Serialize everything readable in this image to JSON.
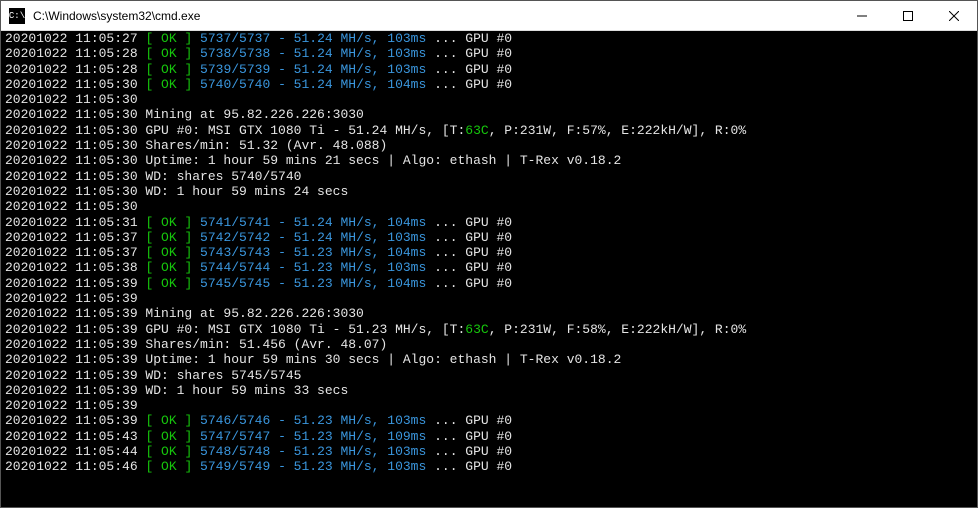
{
  "window": {
    "title": "C:\\Windows\\system32\\cmd.exe",
    "icon_label": "cmd-icon"
  },
  "lines": [
    {
      "segs": [
        {
          "c": "white",
          "t": "20201022 11:05:27 "
        },
        {
          "c": "green",
          "t": "[ OK ]"
        },
        {
          "c": "cyan",
          "t": " 5737/5737 - 51.24 MH/s, 103ms"
        },
        {
          "c": "white",
          "t": " ... GPU #0"
        }
      ]
    },
    {
      "segs": [
        {
          "c": "white",
          "t": "20201022 11:05:28 "
        },
        {
          "c": "green",
          "t": "[ OK ]"
        },
        {
          "c": "cyan",
          "t": " 5738/5738 - 51.24 MH/s, 103ms"
        },
        {
          "c": "white",
          "t": " ... GPU #0"
        }
      ]
    },
    {
      "segs": [
        {
          "c": "white",
          "t": "20201022 11:05:28 "
        },
        {
          "c": "green",
          "t": "[ OK ]"
        },
        {
          "c": "cyan",
          "t": " 5739/5739 - 51.24 MH/s, 103ms"
        },
        {
          "c": "white",
          "t": " ... GPU #0"
        }
      ]
    },
    {
      "segs": [
        {
          "c": "white",
          "t": "20201022 11:05:30 "
        },
        {
          "c": "green",
          "t": "[ OK ]"
        },
        {
          "c": "cyan",
          "t": " 5740/5740 - 51.24 MH/s, 104ms"
        },
        {
          "c": "white",
          "t": " ... GPU #0"
        }
      ]
    },
    {
      "segs": [
        {
          "c": "white",
          "t": "20201022 11:05:30"
        }
      ]
    },
    {
      "segs": [
        {
          "c": "white",
          "t": "20201022 11:05:30 Mining at 95.82.226.226:3030"
        }
      ]
    },
    {
      "segs": [
        {
          "c": "white",
          "t": "20201022 11:05:30 GPU #0: MSI GTX 1080 Ti - 51.24 MH/s, [T:"
        },
        {
          "c": "green",
          "t": "63C"
        },
        {
          "c": "white",
          "t": ", P:231W, F:57%, E:222kH/W], R:0%"
        }
      ]
    },
    {
      "segs": [
        {
          "c": "white",
          "t": "20201022 11:05:30 Shares/min: 51.32 (Avr. 48.088)"
        }
      ]
    },
    {
      "segs": [
        {
          "c": "white",
          "t": "20201022 11:05:30 Uptime: 1 hour 59 mins 21 secs | Algo: ethash | T-Rex v0.18.2"
        }
      ]
    },
    {
      "segs": [
        {
          "c": "white",
          "t": "20201022 11:05:30 WD: shares 5740/5740"
        }
      ]
    },
    {
      "segs": [
        {
          "c": "white",
          "t": "20201022 11:05:30 WD: 1 hour 59 mins 24 secs"
        }
      ]
    },
    {
      "segs": [
        {
          "c": "white",
          "t": "20201022 11:05:30"
        }
      ]
    },
    {
      "segs": [
        {
          "c": "white",
          "t": "20201022 11:05:31 "
        },
        {
          "c": "green",
          "t": "[ OK ]"
        },
        {
          "c": "cyan",
          "t": " 5741/5741 - 51.24 MH/s, 104ms"
        },
        {
          "c": "white",
          "t": " ... GPU #0"
        }
      ]
    },
    {
      "segs": [
        {
          "c": "white",
          "t": "20201022 11:05:37 "
        },
        {
          "c": "green",
          "t": "[ OK ]"
        },
        {
          "c": "cyan",
          "t": " 5742/5742 - 51.24 MH/s, 103ms"
        },
        {
          "c": "white",
          "t": " ... GPU #0"
        }
      ]
    },
    {
      "segs": [
        {
          "c": "white",
          "t": "20201022 11:05:37 "
        },
        {
          "c": "green",
          "t": "[ OK ]"
        },
        {
          "c": "cyan",
          "t": " 5743/5743 - 51.23 MH/s, 104ms"
        },
        {
          "c": "white",
          "t": " ... GPU #0"
        }
      ]
    },
    {
      "segs": [
        {
          "c": "white",
          "t": "20201022 11:05:38 "
        },
        {
          "c": "green",
          "t": "[ OK ]"
        },
        {
          "c": "cyan",
          "t": " 5744/5744 - 51.23 MH/s, 103ms"
        },
        {
          "c": "white",
          "t": " ... GPU #0"
        }
      ]
    },
    {
      "segs": [
        {
          "c": "white",
          "t": "20201022 11:05:39 "
        },
        {
          "c": "green",
          "t": "[ OK ]"
        },
        {
          "c": "cyan",
          "t": " 5745/5745 - 51.23 MH/s, 104ms"
        },
        {
          "c": "white",
          "t": " ... GPU #0"
        }
      ]
    },
    {
      "segs": [
        {
          "c": "white",
          "t": "20201022 11:05:39"
        }
      ]
    },
    {
      "segs": [
        {
          "c": "white",
          "t": "20201022 11:05:39 Mining at 95.82.226.226:3030"
        }
      ]
    },
    {
      "segs": [
        {
          "c": "white",
          "t": "20201022 11:05:39 GPU #0: MSI GTX 1080 Ti - 51.23 MH/s, [T:"
        },
        {
          "c": "green",
          "t": "63C"
        },
        {
          "c": "white",
          "t": ", P:231W, F:58%, E:222kH/W], R:0%"
        }
      ]
    },
    {
      "segs": [
        {
          "c": "white",
          "t": "20201022 11:05:39 Shares/min: 51.456 (Avr. 48.07)"
        }
      ]
    },
    {
      "segs": [
        {
          "c": "white",
          "t": "20201022 11:05:39 Uptime: 1 hour 59 mins 30 secs | Algo: ethash | T-Rex v0.18.2"
        }
      ]
    },
    {
      "segs": [
        {
          "c": "white",
          "t": "20201022 11:05:39 WD: shares 5745/5745"
        }
      ]
    },
    {
      "segs": [
        {
          "c": "white",
          "t": "20201022 11:05:39 WD: 1 hour 59 mins 33 secs"
        }
      ]
    },
    {
      "segs": [
        {
          "c": "white",
          "t": "20201022 11:05:39"
        }
      ]
    },
    {
      "segs": [
        {
          "c": "white",
          "t": "20201022 11:05:39 "
        },
        {
          "c": "green",
          "t": "[ OK ]"
        },
        {
          "c": "cyan",
          "t": " 5746/5746 - 51.23 MH/s, 103ms"
        },
        {
          "c": "white",
          "t": " ... GPU #0"
        }
      ]
    },
    {
      "segs": [
        {
          "c": "white",
          "t": "20201022 11:05:43 "
        },
        {
          "c": "green",
          "t": "[ OK ]"
        },
        {
          "c": "cyan",
          "t": " 5747/5747 - 51.23 MH/s, 109ms"
        },
        {
          "c": "white",
          "t": " ... GPU #0"
        }
      ]
    },
    {
      "segs": [
        {
          "c": "white",
          "t": "20201022 11:05:44 "
        },
        {
          "c": "green",
          "t": "[ OK ]"
        },
        {
          "c": "cyan",
          "t": " 5748/5748 - 51.23 MH/s, 103ms"
        },
        {
          "c": "white",
          "t": " ... GPU #0"
        }
      ]
    },
    {
      "segs": [
        {
          "c": "white",
          "t": "20201022 11:05:46 "
        },
        {
          "c": "green",
          "t": "[ OK ]"
        },
        {
          "c": "cyan",
          "t": " 5749/5749 - 51.23 MH/s, 103ms"
        },
        {
          "c": "white",
          "t": " ... GPU #0"
        }
      ]
    }
  ]
}
